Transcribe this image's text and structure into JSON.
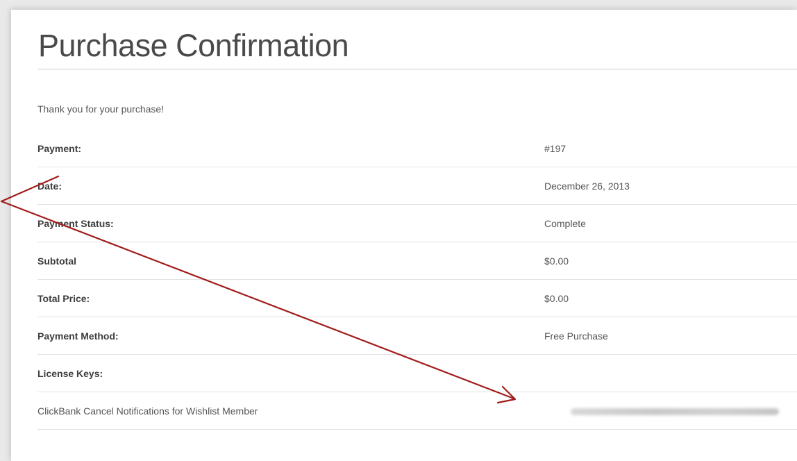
{
  "page": {
    "title": "Purchase Confirmation",
    "thank_you": "Thank you for your purchase!"
  },
  "receipt": {
    "rows": [
      {
        "label": "Payment:",
        "value": "#197"
      },
      {
        "label": "Date:",
        "value": "December 26, 2013"
      },
      {
        "label": "Payment Status:",
        "value": "Complete"
      },
      {
        "label": "Subtotal",
        "value": "$0.00"
      },
      {
        "label": "Total Price:",
        "value": "$0.00"
      },
      {
        "label": "Payment Method:",
        "value": "Free Purchase"
      },
      {
        "label": "License Keys:",
        "value": ""
      },
      {
        "label": "ClickBank Cancel Notifications for Wishlist Member",
        "value": ""
      }
    ]
  },
  "annotation": {
    "color": "#a11c1c",
    "icon": "arrow-icon"
  }
}
